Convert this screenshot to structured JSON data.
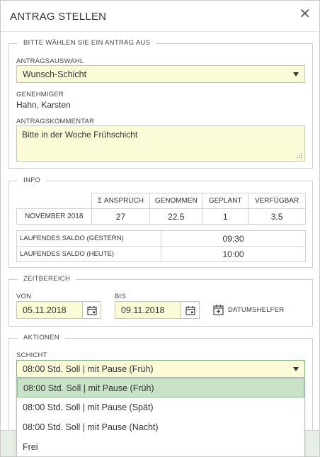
{
  "dialog": {
    "title": "ANTRAG STELLEN",
    "close_glyph": "✕"
  },
  "antrag": {
    "legend": "BITTE WÄHLEN SIE EIN ANTRAG AUS",
    "auswahl_label": "ANTRAGSAUSWAHL",
    "auswahl_value": "Wunsch-Schicht",
    "genehmiger_label": "GENEHMIGER",
    "genehmiger_value": "Hahn, Karsten",
    "kommentar_label": "ANTRAGSKOMMENTAR",
    "kommentar_value": "Bitte in der Woche Frühschicht"
  },
  "info": {
    "legend": "INFO",
    "columns": [
      "Σ ANSPRUCH",
      "GENOMMEN",
      "GEPLANT",
      "VERFÜGBAR"
    ],
    "row": {
      "label": "NOVEMBER 2018",
      "values": [
        "27",
        "22.5",
        "1",
        "3.5"
      ]
    },
    "saldo": [
      {
        "label": "LAUFENDES SALDO (GESTERN)",
        "value": "09:30"
      },
      {
        "label": "LAUFENDES SALDO (HEUTE)",
        "value": "10:00"
      }
    ]
  },
  "zeitbereich": {
    "legend": "ZEITBEREICH",
    "von_label": "VON",
    "von_value": "05.11.2018",
    "bis_label": "BIS",
    "bis_value": "09.11.2018",
    "helper_label": "DATUMSHELFER"
  },
  "aktionen": {
    "legend": "AKTIONEN",
    "schicht_label": "SCHICHT",
    "schicht_value": "08:00 Std. Soll | mit Pause (Früh)",
    "options": [
      "08:00 Std. Soll | mit Pause (Früh)",
      "08:00 Std. Soll | mit Pause (Spät)",
      "08:00 Std. Soll | mit Pause (Nacht)",
      "Frei"
    ],
    "selected_index": 0
  },
  "colors": {
    "input_bg": "#fbfbd8",
    "selected_option_bg": "#c9e3c9",
    "footer_bg": "#e6f0e6"
  },
  "icons": [
    "close-icon",
    "caret-down-icon",
    "resize-grip-icon",
    "calendar-icon",
    "calendar-plus-icon"
  ]
}
